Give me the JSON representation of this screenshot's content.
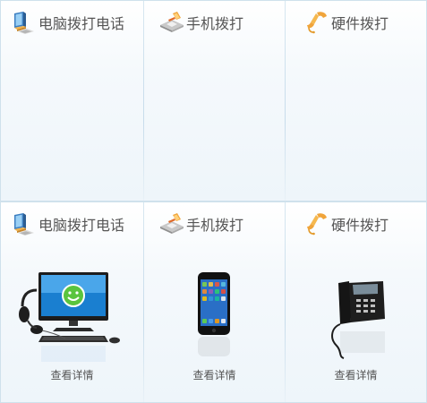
{
  "top_row": {
    "items": [
      {
        "label": "电脑拨打电话",
        "icon": "computer-icon"
      },
      {
        "label": "手机拨打",
        "icon": "phone-card-icon"
      },
      {
        "label": "硬件拨打",
        "icon": "handset-icon"
      }
    ]
  },
  "bottom_row": {
    "items": [
      {
        "label": "电脑拨打电话",
        "icon": "computer-icon",
        "image": "desktop-with-headset",
        "more": "查看详情"
      },
      {
        "label": "手机拨打",
        "icon": "phone-card-icon",
        "image": "smartphone",
        "more": "查看详情"
      },
      {
        "label": "硬件拨打",
        "icon": "handset-icon",
        "image": "desk-phone",
        "more": "查看详情"
      }
    ]
  },
  "colors": {
    "border": "#cfe1ec",
    "text": "#555555",
    "icon_orange": "#f0a43a"
  }
}
